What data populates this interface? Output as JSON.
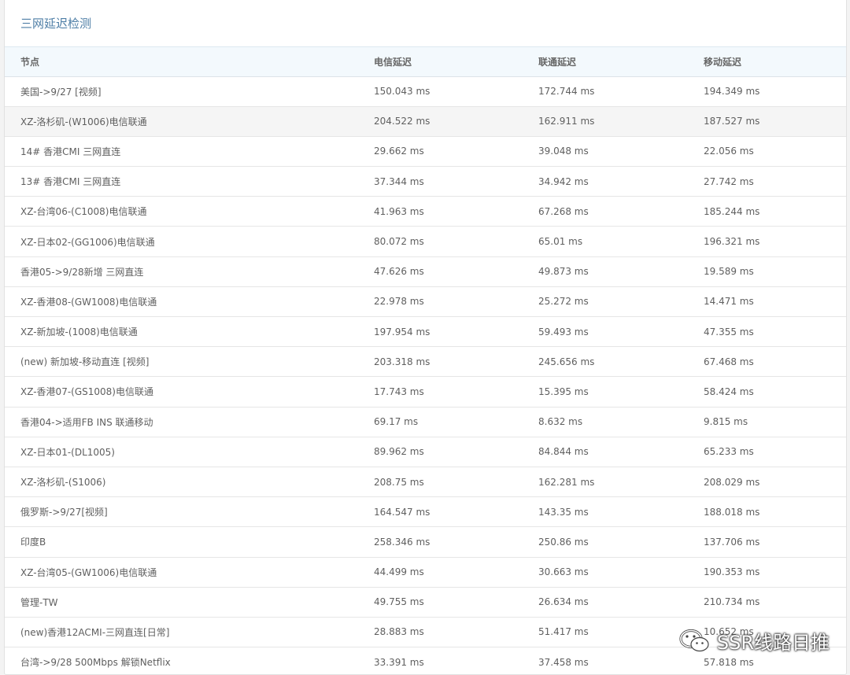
{
  "panel": {
    "title": "三网延迟检测"
  },
  "table": {
    "headers": {
      "node": "节点",
      "ct": "电信延迟",
      "cu": "联通延迟",
      "cm": "移动延迟"
    },
    "rows": [
      {
        "node": "美国->9/27 [视频]",
        "ct": "150.043 ms",
        "cu": "172.744 ms",
        "cm": "194.349 ms"
      },
      {
        "node": "XZ-洛杉矶-(W1006)电信联通",
        "ct": "204.522 ms",
        "cu": "162.911 ms",
        "cm": "187.527 ms"
      },
      {
        "node": "14# 香港CMI 三网直连",
        "ct": "29.662 ms",
        "cu": "39.048 ms",
        "cm": "22.056 ms"
      },
      {
        "node": "13# 香港CMI 三网直连",
        "ct": "37.344 ms",
        "cu": "34.942 ms",
        "cm": "27.742 ms"
      },
      {
        "node": "XZ-台湾06-(C1008)电信联通",
        "ct": "41.963 ms",
        "cu": "67.268 ms",
        "cm": "185.244 ms"
      },
      {
        "node": "XZ-日本02-(GG1006)电信联通",
        "ct": "80.072 ms",
        "cu": "65.01 ms",
        "cm": "196.321 ms"
      },
      {
        "node": "香港05->9/28新增 三网直连",
        "ct": "47.626 ms",
        "cu": "49.873 ms",
        "cm": "19.589 ms"
      },
      {
        "node": "XZ-香港08-(GW1008)电信联通",
        "ct": "22.978 ms",
        "cu": "25.272 ms",
        "cm": "14.471 ms"
      },
      {
        "node": "XZ-新加坡-(1008)电信联通",
        "ct": "197.954 ms",
        "cu": "59.493 ms",
        "cm": "47.355 ms"
      },
      {
        "node": "(new) 新加坡-移动直连 [视频]",
        "ct": "203.318 ms",
        "cu": "245.656 ms",
        "cm": "67.468 ms"
      },
      {
        "node": "XZ-香港07-(GS1008)电信联通",
        "ct": "17.743 ms",
        "cu": "15.395 ms",
        "cm": "58.424 ms"
      },
      {
        "node": "香港04->适用FB INS 联通移动",
        "ct": "69.17 ms",
        "cu": "8.632 ms",
        "cm": "9.815 ms"
      },
      {
        "node": "XZ-日本01-(DL1005)",
        "ct": "89.962 ms",
        "cu": "84.844 ms",
        "cm": "65.233 ms"
      },
      {
        "node": "XZ-洛杉矶-(S1006)",
        "ct": "208.75 ms",
        "cu": "162.281 ms",
        "cm": "208.029 ms"
      },
      {
        "node": "俄罗斯->9/27[视频]",
        "ct": "164.547 ms",
        "cu": "143.35 ms",
        "cm": "188.018 ms"
      },
      {
        "node": "印度B",
        "ct": "258.346 ms",
        "cu": "250.86 ms",
        "cm": "137.706 ms"
      },
      {
        "node": "XZ-台湾05-(GW1006)电信联通",
        "ct": "44.499 ms",
        "cu": "30.663 ms",
        "cm": "190.353 ms"
      },
      {
        "node": "管理-TW",
        "ct": "49.755 ms",
        "cu": "26.634 ms",
        "cm": "210.734 ms"
      },
      {
        "node": "(new)香港12ACMI-三网直连[日常]",
        "ct": "28.883 ms",
        "cu": "51.417 ms",
        "cm": "10.652 ms"
      },
      {
        "node": "台湾->9/28 500Mbps 解锁Netflix",
        "ct": "33.391 ms",
        "cu": "37.458 ms",
        "cm": "57.818 ms"
      }
    ]
  },
  "watermark": {
    "text": "SSR线路日推",
    "icon": "wechat-icon"
  }
}
